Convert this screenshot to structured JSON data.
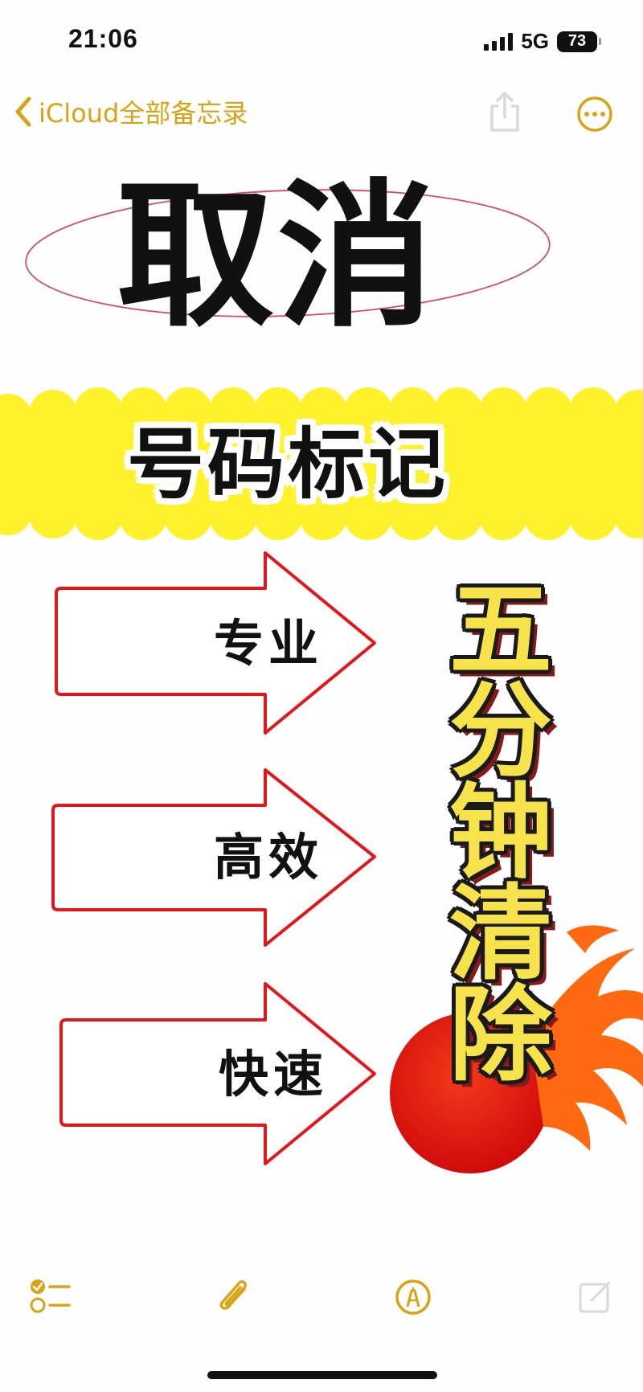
{
  "status_bar": {
    "time": "21:06",
    "network": "5G",
    "battery": "73"
  },
  "nav": {
    "back_label": "iCloud全部备忘录",
    "accent_color": "#d8a415"
  },
  "note": {
    "title": "取消",
    "banner": "号码标记",
    "arrows": [
      {
        "label": "专业"
      },
      {
        "label": "高效"
      },
      {
        "label": "快速"
      }
    ],
    "headline_chars": [
      "五",
      "分",
      "钟",
      "清",
      "除"
    ],
    "colors": {
      "banner_yellow": "#fff12a",
      "arrow_red": "#e3161b",
      "headline_yellow": "#f6e24a",
      "flame": "#ff6a10",
      "sun_red": "#e41212"
    }
  },
  "toolbar": {
    "icons": [
      "checklist-icon",
      "paperclip-icon",
      "markup-pen-icon",
      "compose-icon"
    ]
  }
}
